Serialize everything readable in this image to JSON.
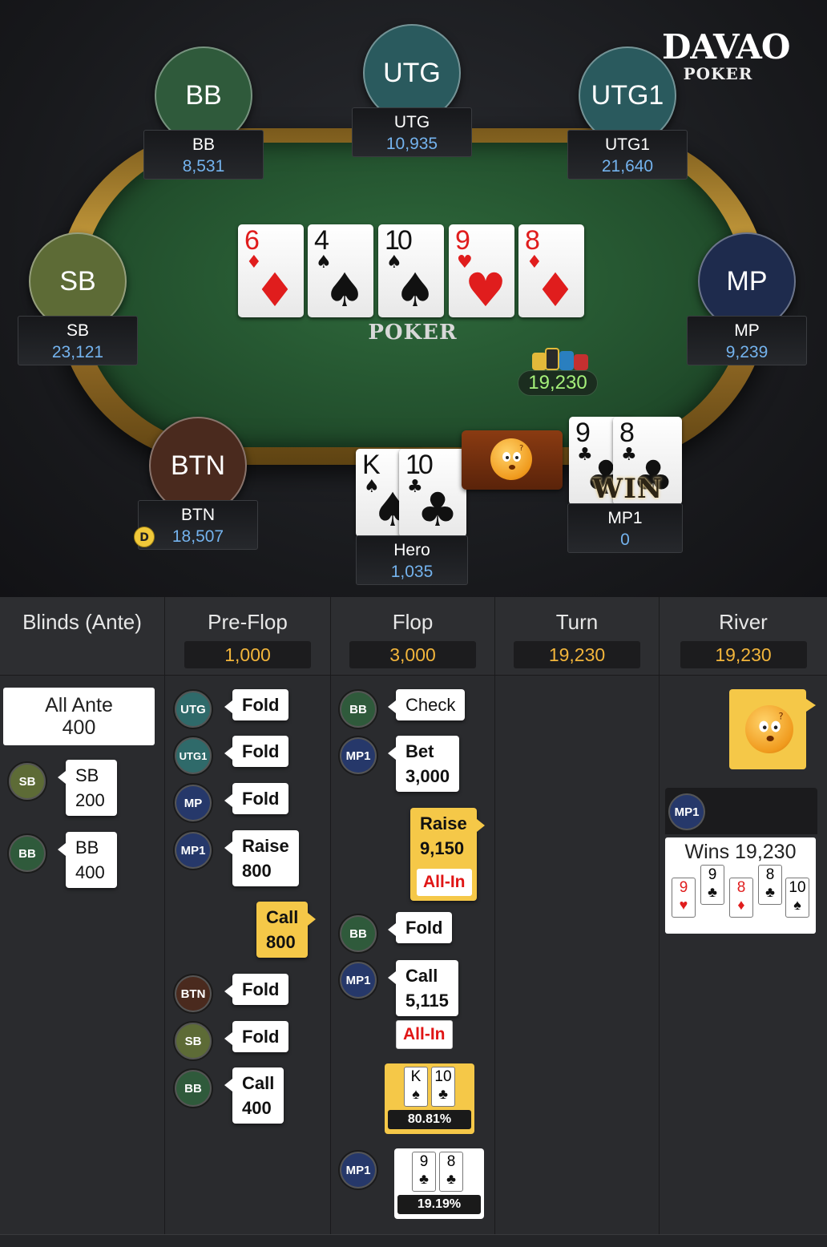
{
  "logo": {
    "main": "DAVAO",
    "sub": "POKER"
  },
  "table_brand": "POKER",
  "seats": {
    "bb": {
      "avatar": "BB",
      "name": "BB",
      "stack": "8,531",
      "color": "#2f5a3b"
    },
    "utg": {
      "avatar": "UTG",
      "name": "UTG",
      "stack": "10,935",
      "color": "#2a5a5e"
    },
    "utg1": {
      "avatar": "UTG1",
      "name": "UTG1",
      "stack": "21,640",
      "color": "#2a5a5e"
    },
    "sb": {
      "avatar": "SB",
      "name": "SB",
      "stack": "23,121",
      "color": "#5d6b36"
    },
    "mp": {
      "avatar": "MP",
      "name": "MP",
      "stack": "9,239",
      "color": "#1e2b4d"
    },
    "btn": {
      "avatar": "BTN",
      "name": "BTN",
      "stack": "18,507",
      "color": "#4a2a1e",
      "dealer": "D"
    },
    "hero": {
      "name": "Hero",
      "stack": "1,035"
    },
    "mp1": {
      "name": "MP1",
      "stack": "0"
    }
  },
  "board": [
    {
      "rank": "6",
      "suit": "♦",
      "color": "red"
    },
    {
      "rank": "4",
      "suit": "♠",
      "color": "black"
    },
    {
      "rank": "10",
      "suit": "♠",
      "color": "black"
    },
    {
      "rank": "9",
      "suit": "♥",
      "color": "red"
    },
    {
      "rank": "8",
      "suit": "♦",
      "color": "red"
    }
  ],
  "hero_cards": [
    {
      "rank": "K",
      "suit": "♠",
      "color": "black"
    },
    {
      "rank": "10",
      "suit": "♣",
      "color": "black"
    }
  ],
  "mp1_cards": [
    {
      "rank": "9",
      "suit": "♣",
      "color": "black"
    },
    {
      "rank": "8",
      "suit": "♣",
      "color": "black"
    }
  ],
  "pot": "19,230",
  "win_label": "WIN",
  "emote_icon": "confused-face-emoji",
  "history": {
    "columns": [
      {
        "label": "Blinds (Ante)",
        "pot": ""
      },
      {
        "label": "Pre-Flop",
        "pot": "1,000"
      },
      {
        "label": "Flop",
        "pot": "3,000"
      },
      {
        "label": "Turn",
        "pot": "19,230"
      },
      {
        "label": "River",
        "pot": "19,230"
      }
    ],
    "blinds": {
      "ante_line1": "All Ante",
      "ante_line2": "400",
      "sb": {
        "pos": "SB",
        "line1": "SB",
        "line2": "200"
      },
      "bb": {
        "pos": "BB",
        "line1": "BB",
        "line2": "400"
      }
    },
    "preflop": [
      {
        "pos": "UTG",
        "line1": "Fold"
      },
      {
        "pos": "UTG1",
        "line1": "Fold"
      },
      {
        "pos": "MP",
        "line1": "Fold"
      },
      {
        "pos": "MP1",
        "line1": "Raise",
        "line2": "800"
      },
      {
        "hero": true,
        "line1": "Call",
        "line2": "800"
      },
      {
        "pos": "BTN",
        "line1": "Fold"
      },
      {
        "pos": "SB",
        "line1": "Fold"
      },
      {
        "pos": "BB",
        "line1": "Call",
        "line2": "400"
      }
    ],
    "flop": [
      {
        "pos": "BB",
        "line1": "Check"
      },
      {
        "pos": "MP1",
        "line1": "Bet",
        "line2": "3,000"
      },
      {
        "hero": true,
        "line1": "Raise",
        "line2": "9,150",
        "allin": "All-In"
      },
      {
        "pos": "BB",
        "line1": "Fold"
      },
      {
        "pos": "MP1",
        "line1": "Call",
        "line2": "5,115",
        "allin": "All-In"
      }
    ],
    "showdown": {
      "hero": {
        "cards": [
          {
            "rank": "K",
            "suit": "♠",
            "color": "black"
          },
          {
            "rank": "10",
            "suit": "♣",
            "color": "black"
          }
        ],
        "equity": "80.81%"
      },
      "mp1": {
        "pos": "MP1",
        "cards": [
          {
            "rank": "9",
            "suit": "♣",
            "color": "black"
          },
          {
            "rank": "8",
            "suit": "♣",
            "color": "black"
          }
        ],
        "equity": "19.19%"
      }
    },
    "river": {
      "winner_pos": "MP1",
      "wins_text": "Wins 19,230",
      "hand": [
        {
          "rank": "9",
          "suit": "♥",
          "color": "red"
        },
        {
          "rank": "9",
          "suit": "♣",
          "color": "black"
        },
        {
          "rank": "8",
          "suit": "♦",
          "color": "red"
        },
        {
          "rank": "8",
          "suit": "♣",
          "color": "black"
        },
        {
          "rank": "10",
          "suit": "♠",
          "color": "black"
        }
      ]
    }
  },
  "badge_colors": {
    "UTG": "#2f6a6a",
    "UTG1": "#2f6a6a",
    "MP": "#26386a",
    "MP1": "#26386a",
    "BTN": "#4a2a1e",
    "SB": "#5d6b36",
    "BB": "#2f5a3b"
  }
}
